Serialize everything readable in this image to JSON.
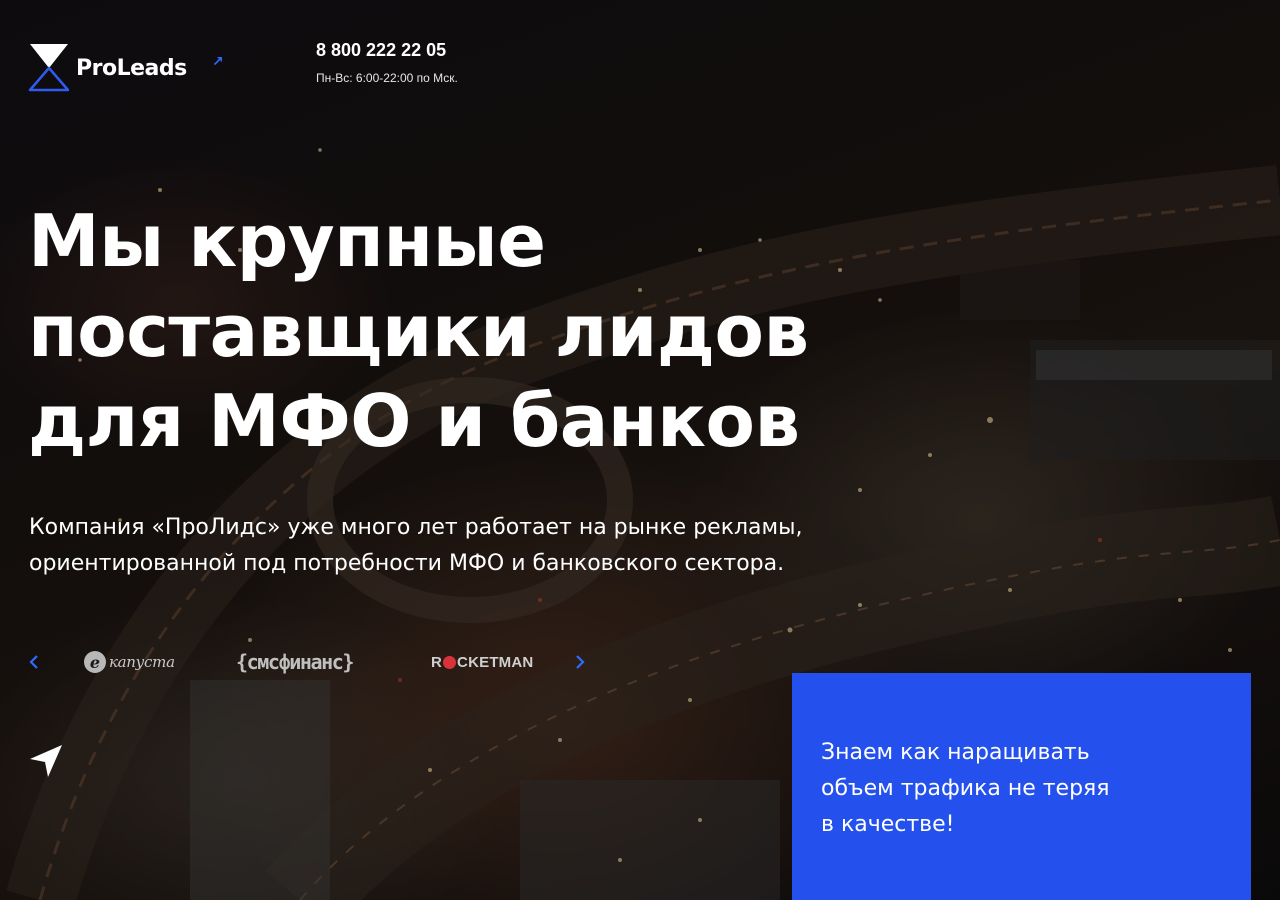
{
  "brand": {
    "name": "ProLeads",
    "accent_color": "#2f6bff"
  },
  "header": {
    "phone": "8 800 222 22 05",
    "hours": "Пн-Вс: 6:00-22:00 по Мск."
  },
  "hero": {
    "headline_lines": [
      "Мы крупные",
      "поставщики лидов",
      "для МФО и банков"
    ],
    "subtitle_lines": [
      "Компания «ПроЛидс» уже много лет работает на рынке рекламы,",
      "ориентированной под потребности МФО и банковского сектора."
    ]
  },
  "partners": {
    "prev_icon": "chevron-left-icon",
    "next_icon": "chevron-right-icon",
    "items": [
      {
        "id": "ekapusta",
        "mark": "e",
        "name": "капуста"
      },
      {
        "id": "smsfinance",
        "name": "{смсфинанс}"
      },
      {
        "id": "rocketman",
        "before": "R",
        "after": "CKETMAN",
        "dot_color": "#d8323a"
      }
    ]
  },
  "nav_icon": "location-arrow-icon",
  "info_card": {
    "bg_color": "#2451ee",
    "lines": [
      "Знаем как наращивать",
      "объем трафика не теряя",
      "в качестве!"
    ]
  }
}
